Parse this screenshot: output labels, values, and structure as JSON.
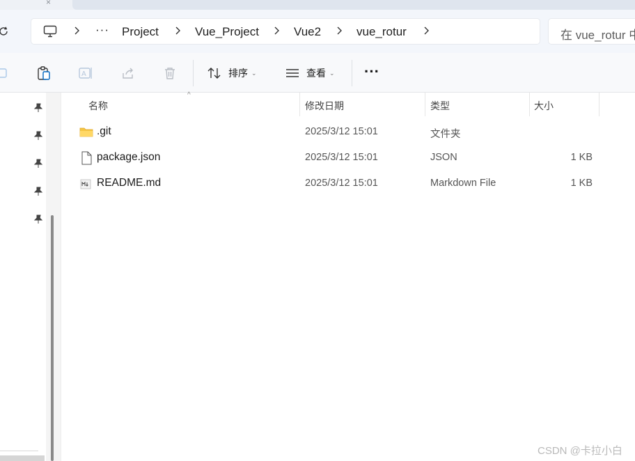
{
  "address_bar": {
    "overflow": "···",
    "crumbs": [
      "Project",
      "Vue_Project",
      "Vue2",
      "vue_rotur"
    ],
    "search_placeholder": "在 vue_rotur 中搜索"
  },
  "toolbar": {
    "sort_label": "排序",
    "view_label": "查看",
    "more_label": "···"
  },
  "icons": {
    "refresh": "refresh-icon",
    "computer": "monitor-icon",
    "cut": "cut-icon",
    "paste": "paste-icon",
    "rename": "rename-icon",
    "share": "share-icon",
    "delete": "trash-icon",
    "sort": "sort-icon",
    "view": "view-list-icon",
    "pin": "pin-icon"
  },
  "columns": [
    "名称",
    "修改日期",
    "类型",
    "大小"
  ],
  "files": [
    {
      "name": ".git",
      "date": "2025/3/12 15:01",
      "type": "文件夹",
      "size": "",
      "icon": "folder-icon"
    },
    {
      "name": "package.json",
      "date": "2025/3/12 15:01",
      "type": "JSON",
      "size": "1 KB",
      "icon": "file-icon"
    },
    {
      "name": "README.md",
      "date": "2025/3/12 15:01",
      "type": "Markdown File",
      "size": "1 KB",
      "icon": "markdown-file-icon"
    }
  ],
  "watermark": "CSDN @卡拉小白",
  "colors": {
    "folder": "#f5c542",
    "accent": "#0067c0",
    "header_bg": "#f3f6fb"
  }
}
